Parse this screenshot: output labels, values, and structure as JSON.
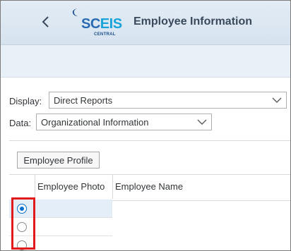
{
  "header": {
    "title": "Employee Information",
    "logo": {
      "brand_a": "SC",
      "brand_b": "EIS",
      "subtitle": "CENTRAL"
    }
  },
  "filters": {
    "display_label": "Display:",
    "display_value": "Direct Reports",
    "data_label": "Data:",
    "data_value": "Organizational Information"
  },
  "toolbar": {
    "profile_button": "Employee Profile"
  },
  "table": {
    "headers": [
      "Employee Photo",
      "Employee Name"
    ],
    "rows": [
      {
        "selected": true
      },
      {
        "selected": false
      },
      {
        "selected": false
      }
    ]
  },
  "colors": {
    "shell_bg": "#d6e3ef",
    "accent": "#0a6ed1",
    "highlight": "#e11b1b",
    "selected_row": "#e3eef9"
  },
  "icons": [
    "chevron-left-icon",
    "chevron-down-icon",
    "radio-button"
  ]
}
